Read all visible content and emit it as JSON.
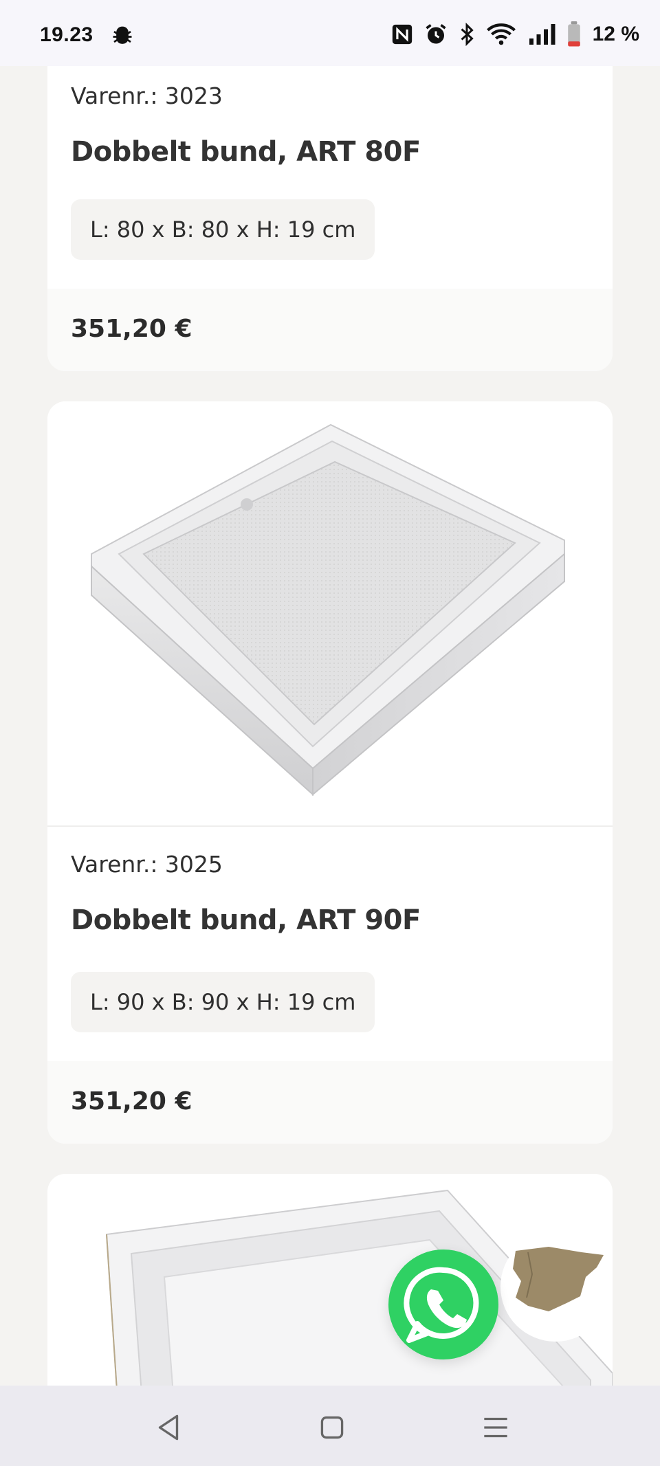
{
  "status_bar": {
    "time": "19.23",
    "battery": "12 %"
  },
  "products": [
    {
      "item_number": "Varenr.: 3023",
      "title": "Dobbelt bund, ART 80F",
      "dimensions": "L: 80 x B: 80 x H: 19 cm",
      "price": "351,20 €"
    },
    {
      "item_number": "Varenr.: 3025",
      "title": "Dobbelt bund, ART 90F",
      "dimensions": "L: 90 x B: 90 x H: 19 cm",
      "price": "351,20 €"
    }
  ],
  "colors": {
    "background": "#f4f3f1",
    "card": "#ffffff",
    "whatsapp": "#2fd163",
    "spain_map": "#9c8a68"
  },
  "icons": [
    "bug-icon",
    "nfc-icon",
    "alarm-icon",
    "bluetooth-icon",
    "wifi-icon",
    "signal-icon",
    "battery-icon",
    "whatsapp-icon",
    "spain-map-icon",
    "back-icon",
    "home-icon",
    "recents-icon"
  ]
}
